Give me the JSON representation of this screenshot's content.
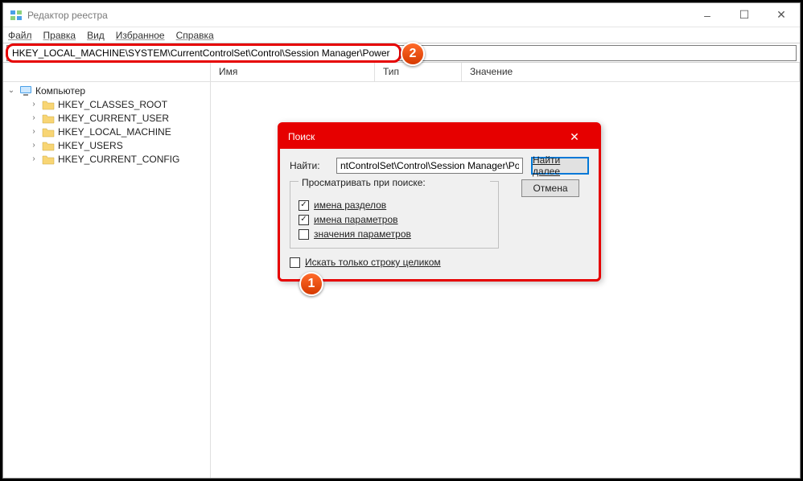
{
  "window": {
    "title": "Редактор реестра",
    "minimize": "–",
    "maximize": "☐",
    "close": "✕"
  },
  "menu": {
    "file": "Файл",
    "edit": "Правка",
    "view": "Вид",
    "favorites": "Избранное",
    "help": "Справка"
  },
  "address": {
    "path": "HKEY_LOCAL_MACHINE\\SYSTEM\\CurrentControlSet\\Control\\Session Manager\\Power"
  },
  "columns": {
    "name": "Имя",
    "type": "Тип",
    "value": "Значение"
  },
  "tree": {
    "root": "Компьютер",
    "items": [
      "HKEY_CLASSES_ROOT",
      "HKEY_CURRENT_USER",
      "HKEY_LOCAL_MACHINE",
      "HKEY_USERS",
      "HKEY_CURRENT_CONFIG"
    ]
  },
  "dialog": {
    "title": "Поиск",
    "close": "✕",
    "findLabel": "Найти:",
    "findValue": "ntControlSet\\Control\\Session Manager\\Power",
    "findNext": "Найти далее",
    "cancel": "Отмена",
    "lookAtLegend": "Просматривать при поиске:",
    "checkKeys": "имена разделов",
    "checkValues": "имена параметров",
    "checkData": "значения параметров",
    "wholeString": "Искать только строку целиком",
    "checkedKeys": "✓",
    "checkedValues": "✓",
    "checkedData": "",
    "checkedWhole": ""
  },
  "badges": {
    "one": "1",
    "two": "2"
  }
}
